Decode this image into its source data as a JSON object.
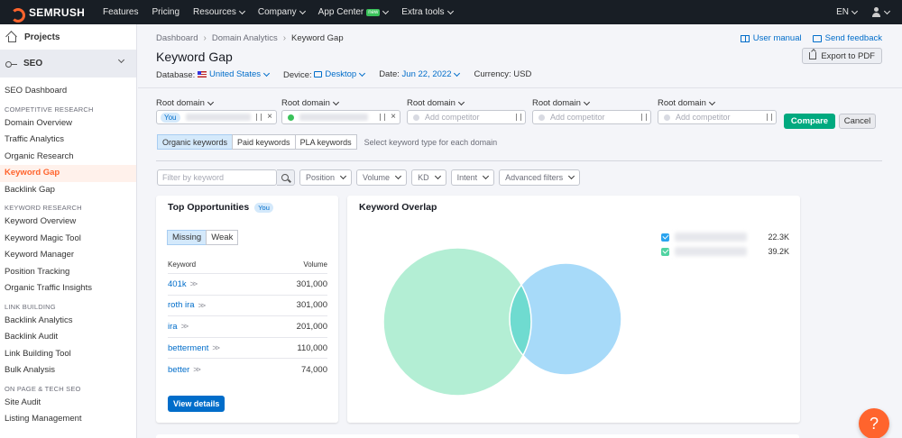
{
  "topnav": {
    "logo": "SEMRUSH",
    "items": [
      {
        "label": "Features",
        "dropdown": false
      },
      {
        "label": "Pricing",
        "dropdown": false
      },
      {
        "label": "Resources",
        "dropdown": true
      },
      {
        "label": "Company",
        "dropdown": true
      },
      {
        "label": "App Center",
        "dropdown": true,
        "badge": "new"
      },
      {
        "label": "Extra tools",
        "dropdown": true
      }
    ],
    "language": "EN"
  },
  "sidebar": {
    "projects": "Projects",
    "seo": "SEO",
    "dashboard": "SEO Dashboard",
    "sections": [
      {
        "title": "COMPETITIVE RESEARCH",
        "items": [
          "Domain Overview",
          "Traffic Analytics",
          "Organic Research",
          "Keyword Gap",
          "Backlink Gap"
        ]
      },
      {
        "title": "KEYWORD RESEARCH",
        "items": [
          "Keyword Overview",
          "Keyword Magic Tool",
          "Keyword Manager",
          "Position Tracking",
          "Organic Traffic Insights"
        ]
      },
      {
        "title": "LINK BUILDING",
        "items": [
          "Backlink Analytics",
          "Backlink Audit",
          "Link Building Tool",
          "Bulk Analysis"
        ]
      },
      {
        "title": "ON PAGE & TECH SEO",
        "items": [
          "Site Audit",
          "Listing Management"
        ]
      }
    ],
    "active": "Keyword Gap"
  },
  "breadcrumb": [
    "Dashboard",
    "Domain Analytics",
    "Keyword Gap"
  ],
  "links": {
    "user_manual": "User manual",
    "send_feedback": "Send feedback"
  },
  "page_title": "Keyword Gap",
  "export_label": "Export to PDF",
  "filters": {
    "database_label": "Database:",
    "database_value": "United States",
    "device_label": "Device:",
    "device_value": "Desktop",
    "date_label": "Date:",
    "date_value": "Jun 22, 2022",
    "currency_label": "Currency: USD"
  },
  "domains": {
    "label": "Root domain",
    "you_badge": "You",
    "placeholder": "Add competitor",
    "compare": "Compare",
    "cancel": "Cancel"
  },
  "kw_types": {
    "options": [
      "Organic keywords",
      "Paid keywords",
      "PLA keywords"
    ],
    "selected": "Organic keywords",
    "hint": "Select keyword type for each domain"
  },
  "filterbar": {
    "placeholder": "Filter by keyword",
    "dropdowns": [
      "Position",
      "Volume",
      "KD",
      "Intent",
      "Advanced filters"
    ]
  },
  "opportunities": {
    "title": "Top Opportunities",
    "badge": "You",
    "tabs": [
      "Missing",
      "Weak"
    ],
    "selected_tab": "Missing",
    "col_keyword": "Keyword",
    "col_volume": "Volume",
    "rows": [
      {
        "keyword": "401k",
        "volume": "301,000"
      },
      {
        "keyword": "roth ira",
        "volume": "301,000"
      },
      {
        "keyword": "ira",
        "volume": "201,000"
      },
      {
        "keyword": "betterment",
        "volume": "110,000"
      },
      {
        "keyword": "better",
        "volume": "74,000"
      }
    ],
    "view_details": "View details"
  },
  "overlap": {
    "title": "Keyword Overlap",
    "legend": [
      {
        "value": "22.3K",
        "color": "#2ba4ef"
      },
      {
        "value": "39.2K",
        "color": "#50d3a1"
      }
    ],
    "colors": {
      "green": "#b3eed4",
      "blue": "#a7daf9",
      "intersection": "#6fdbd0"
    }
  },
  "help": "?"
}
